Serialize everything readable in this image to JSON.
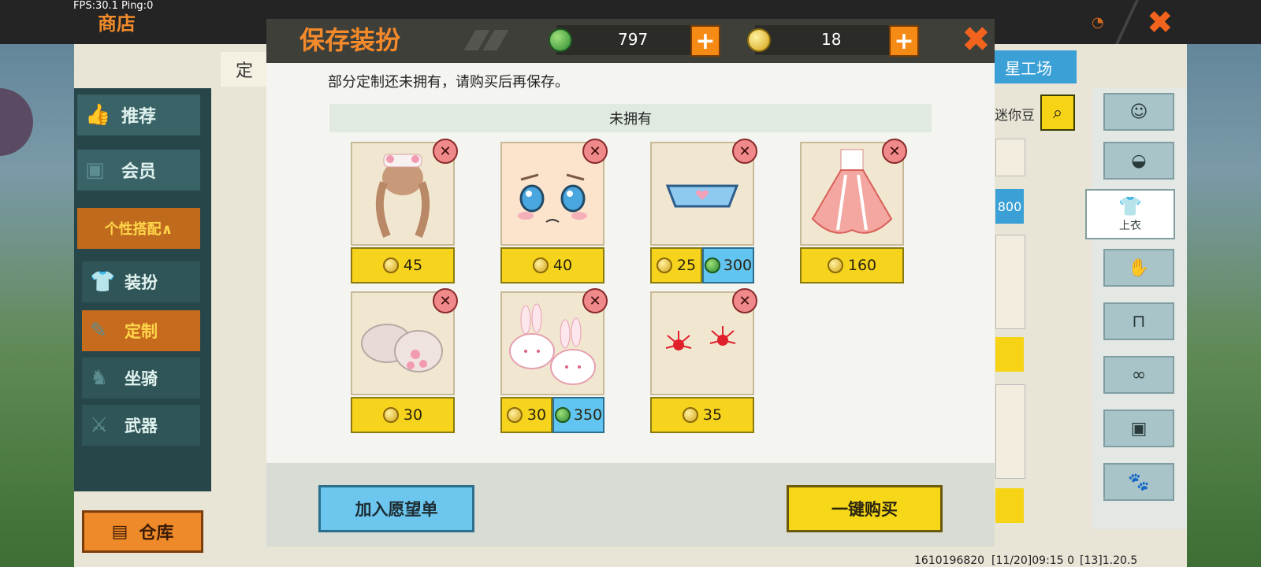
{
  "hud": {
    "fps_text": "FPS:30.1  Ping:0",
    "shop_title": "商店"
  },
  "sidebar": {
    "items": [
      {
        "label": "推荐"
      },
      {
        "label": "会员"
      },
      {
        "label": "个性搭配∧"
      },
      {
        "label": "装扮"
      },
      {
        "label": "定制"
      },
      {
        "label": "坐骑"
      },
      {
        "label": "武器"
      }
    ],
    "warehouse_label": "仓库"
  },
  "back_page": {
    "tab_label": "定",
    "workshop_label": "星工场",
    "mini_bean_label": "迷你豆",
    "price_peek": "800",
    "category_active_label": "上衣"
  },
  "modal": {
    "title": "保存装扮",
    "gem_balance": "797",
    "coin_balance": "18",
    "notice": "部分定制还未拥有，请购买后再保存。",
    "section_title": "未拥有",
    "wishlist_label": "加入愿望单",
    "buy_all_label": "一键购买",
    "items": [
      {
        "name": "hair-item",
        "coin": "45",
        "gem": null
      },
      {
        "name": "face-item",
        "coin": "40",
        "gem": null
      },
      {
        "name": "mask-item",
        "coin": "25",
        "gem": "300"
      },
      {
        "name": "dress-item",
        "coin": "160",
        "gem": null
      },
      {
        "name": "paw-gloves-item",
        "coin": "30",
        "gem": null
      },
      {
        "name": "bunny-slippers-item",
        "coin": "30",
        "gem": "350"
      },
      {
        "name": "flower-item",
        "coin": "35",
        "gem": null
      }
    ]
  },
  "status_bar": {
    "uid": "1610196820",
    "date": "[11/20]09:15 0",
    "version": "[13]1.20.5"
  },
  "colors": {
    "accent_orange": "#f58a2a",
    "coin_yellow": "#f6d31c",
    "gem_blue": "#62c4f0"
  }
}
